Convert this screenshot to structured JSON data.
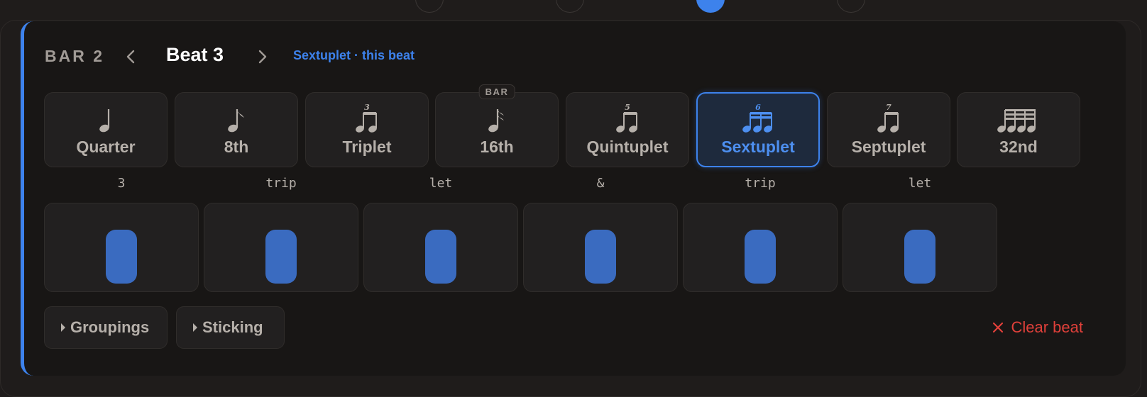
{
  "header": {
    "bar_label": "BAR 2",
    "beat_title": "Beat 3",
    "subdivision_note": "Sextuplet · this beat"
  },
  "note_values": [
    {
      "label": "Quarter",
      "icon": "quarter-note-icon",
      "tuplet": ""
    },
    {
      "label": "8th",
      "icon": "eighth-note-icon",
      "tuplet": ""
    },
    {
      "label": "Triplet",
      "icon": "beamed-notes-icon",
      "tuplet": "3"
    },
    {
      "label": "16th",
      "icon": "sixteenth-note-icon",
      "tuplet": "",
      "badge": "BAR"
    },
    {
      "label": "Quintuplet",
      "icon": "beamed-notes-icon",
      "tuplet": "5"
    },
    {
      "label": "Sextuplet",
      "icon": "beamed-sixteenths-icon",
      "tuplet": "6",
      "selected": true
    },
    {
      "label": "Septuplet",
      "icon": "beamed-notes-icon",
      "tuplet": "7"
    },
    {
      "label": "32nd",
      "icon": "beamed-thirty-seconds-icon",
      "tuplet": ""
    }
  ],
  "subdivisions": [
    "3",
    "trip",
    "let",
    "&",
    "trip",
    "let"
  ],
  "footer": {
    "groupings_label": "Groupings",
    "sticking_label": "Sticking",
    "clear_label": "Clear beat"
  },
  "colors": {
    "accent": "#3d82ec",
    "pad_fill": "#3a6bc0",
    "danger": "#e0403a"
  }
}
